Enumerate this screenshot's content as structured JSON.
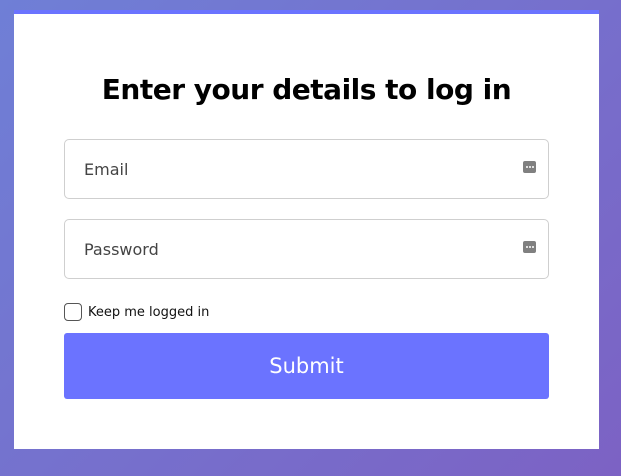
{
  "form": {
    "title": "Enter your details to log in",
    "email_placeholder": "Email",
    "email_value": "",
    "password_placeholder": "Password",
    "password_value": "",
    "keep_logged_in_label": "Keep me logged in",
    "keep_logged_in_checked": false,
    "submit_label": "Submit",
    "password_manager_icon": "password-manager-key-icon"
  },
  "colors": {
    "accent": "#6b73ff",
    "background_gradient_start": "#6f7fd6",
    "background_gradient_end": "#7c62c4",
    "card": "#ffffff"
  }
}
